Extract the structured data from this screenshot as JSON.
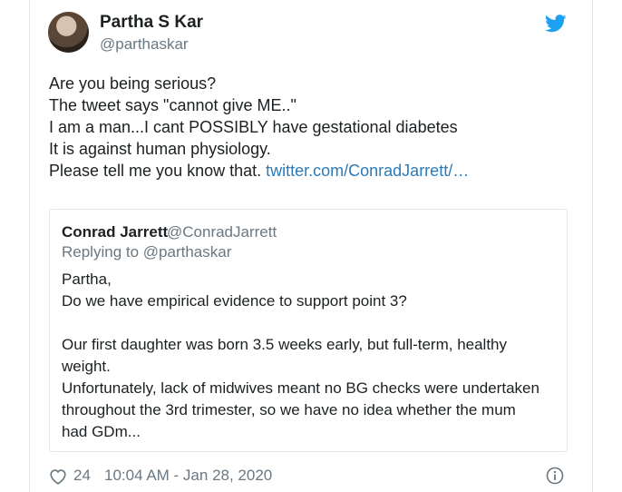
{
  "author": {
    "display_name": "Partha S Kar",
    "handle": "@parthaskar"
  },
  "tweet": {
    "lines": [
      "Are you being serious?",
      "The tweet says \"cannot give ME..\"",
      "I am a man...I cant POSSIBLY have gestational diabetes",
      "It is against human physiology."
    ],
    "last_line_text": "Please tell me you know that. ",
    "link_text": "twitter.com/ConradJarrett/…"
  },
  "quoted": {
    "display_name": "Conrad Jarrett",
    "handle": "@ConradJarrett",
    "replying_to": "Replying to @parthaskar",
    "lines": [
      "Partha,",
      "Do we have empirical evidence to support point 3?",
      "",
      "Our first daughter was born  3.5 weeks early, but full-term, healthy",
      "weight.",
      "Unfortunately, lack of midwives meant no BG checks were undertaken",
      "throughout the 3rd trimester, so we have no idea whether the mum",
      "had GDm..."
    ]
  },
  "footer": {
    "like_count": "24",
    "timestamp": "10:04 AM - Jan 28, 2020"
  },
  "icons": {
    "twitter_logo": "twitter-bird-icon",
    "like": "heart-icon",
    "info": "info-icon"
  },
  "colors": {
    "brand": "#1da1f2",
    "link": "#2b7bb9",
    "secondary_text": "#697882",
    "border": "#e1e8ed"
  }
}
